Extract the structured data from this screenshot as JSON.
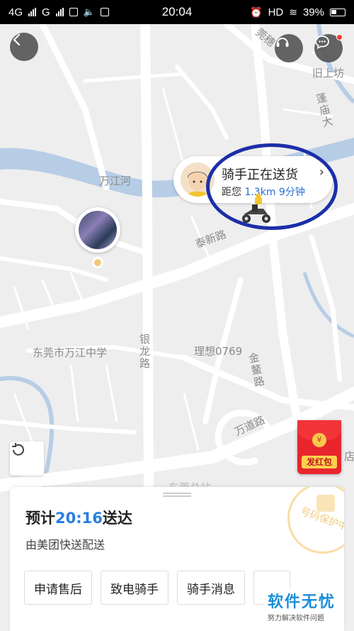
{
  "status_bar": {
    "network_left": "4G",
    "network_right": "G",
    "time": "20:04",
    "hd": "HD",
    "battery": "39%"
  },
  "map": {
    "labels": {
      "wanjiang_river": "万江河",
      "taixin_road": "泰新路",
      "yinlong_road": "银龙路",
      "jinao_road": "金鳌路",
      "wandao_road": "万道路",
      "school": "东莞市万江中学",
      "lixiang": "理想0769",
      "jiushangfang": "旧上坊",
      "penghe_road": "蓬庙大",
      "top_road": "莞穗",
      "dian": "店",
      "bottom_faded": "东莞总站"
    }
  },
  "rider_bubble": {
    "title": "骑手正在送货",
    "distance_prefix": "距您",
    "distance": "1.3km",
    "eta_minutes": "9分钟",
    "arrow": "›"
  },
  "red_packet": {
    "label": "发红包",
    "coin": "¥"
  },
  "order_card": {
    "eta_prefix": "预计",
    "eta_time": "20:16",
    "eta_suffix": "送达",
    "carrier": "由美团快送配送",
    "stamp_text": "号码保护中",
    "actions": [
      "申请售后",
      "致电骑手",
      "骑手消息",
      ""
    ]
  },
  "watermark": {
    "title": "软件无忧",
    "subtitle": "努力解决软件问题"
  },
  "colors": {
    "accent_blue": "#2a7ee0",
    "annotation_blue": "#1b2fa8",
    "red_packet": "#e8252c"
  }
}
